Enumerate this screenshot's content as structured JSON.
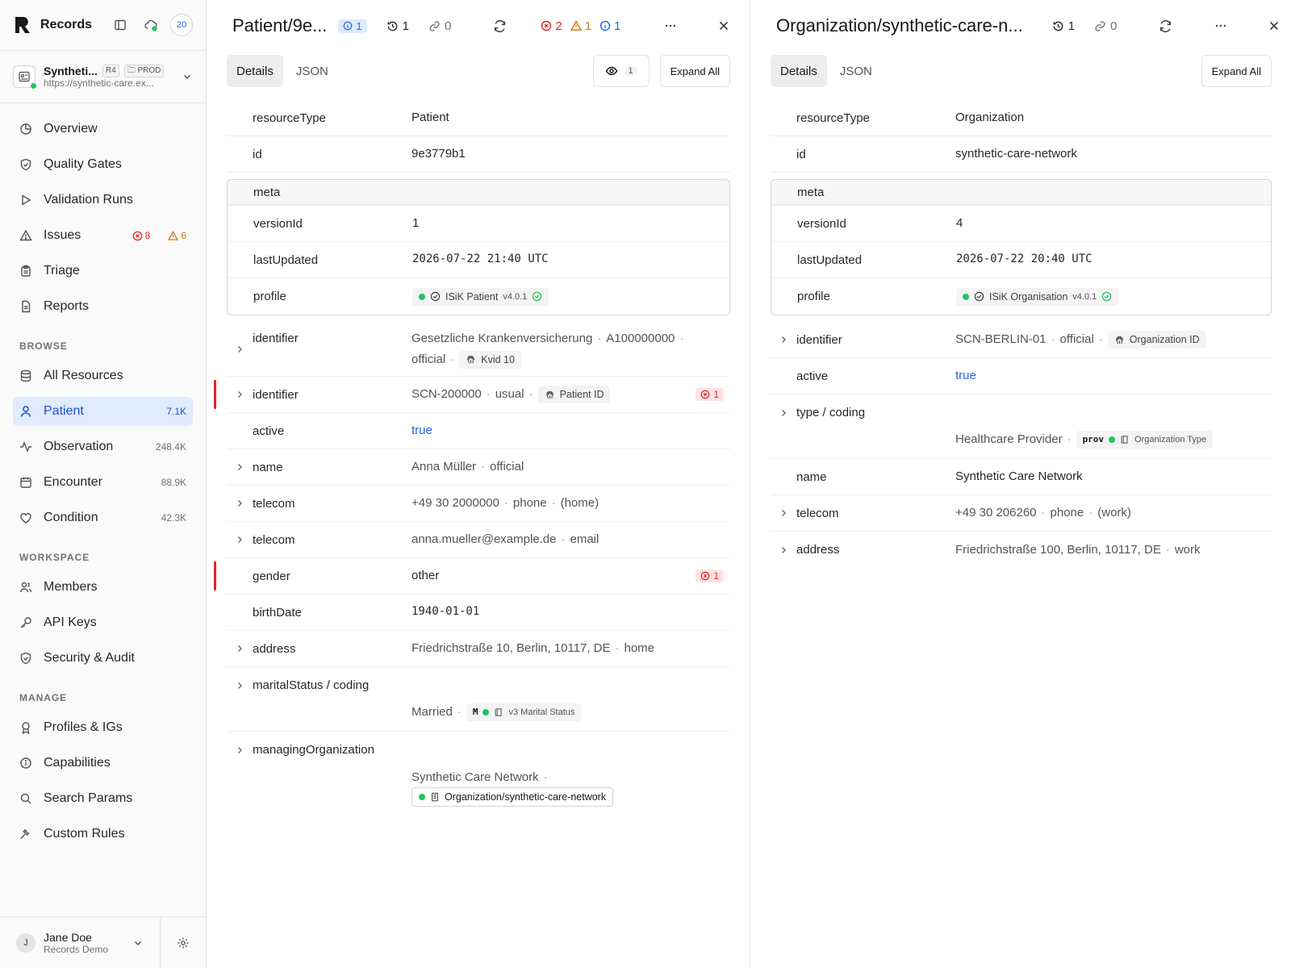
{
  "sidebar": {
    "app_name": "Records",
    "notif_count": "20",
    "workspace": {
      "name": "Syntheti...",
      "fhir": "R4",
      "env": "PROD",
      "url": "https://synthetic-care.ex..."
    },
    "nav_main": [
      {
        "label": "Overview",
        "icon": "pie-chart-icon"
      },
      {
        "label": "Quality Gates",
        "icon": "shield-check-icon"
      },
      {
        "label": "Validation Runs",
        "icon": "play-icon"
      },
      {
        "label": "Issues",
        "icon": "warning-icon",
        "errors": "8",
        "warnings": "6"
      },
      {
        "label": "Triage",
        "icon": "clipboard-icon"
      },
      {
        "label": "Reports",
        "icon": "document-icon"
      }
    ],
    "browse_title": "BROWSE",
    "nav_browse": [
      {
        "label": "All Resources",
        "count": ""
      },
      {
        "label": "Patient",
        "count": "7.1K"
      },
      {
        "label": "Observation",
        "count": "248.4K"
      },
      {
        "label": "Encounter",
        "count": "88.9K"
      },
      {
        "label": "Condition",
        "count": "42.3K"
      }
    ],
    "workspace_title": "WORKSPACE",
    "nav_workspace": [
      {
        "label": "Members"
      },
      {
        "label": "API Keys"
      },
      {
        "label": "Security & Audit"
      }
    ],
    "manage_title": "MANAGE",
    "nav_manage": [
      {
        "label": "Profiles & IGs"
      },
      {
        "label": "Capabilities"
      },
      {
        "label": "Search Params"
      },
      {
        "label": "Custom Rules"
      }
    ],
    "user": {
      "initial": "J",
      "name": "Jane Doe",
      "org": "Records Demo"
    }
  },
  "left": {
    "title": "Patient/9e...",
    "info_badge": "1",
    "history": "1",
    "links": "0",
    "errors": "2",
    "warnings": "1",
    "infos": "1",
    "tab_details": "Details",
    "tab_json": "JSON",
    "eye_count": "1",
    "expand_all": "Expand All",
    "resourceType_key": "resourceType",
    "resourceType": "Patient",
    "id_key": "id",
    "id": "9e3779b1",
    "meta_key": "meta",
    "versionId_key": "versionId",
    "versionId": "1",
    "lastUpdated_key": "lastUpdated",
    "lastUpdated": "2026-07-22 21:40 UTC",
    "profile_key": "profile",
    "profile_name": "ISiK Patient",
    "profile_ver": "v4.0.1",
    "identifier_key": "identifier",
    "id1_type": "Gesetzliche Krankenversicherung",
    "id1_value": "A100000000",
    "id1_use": "official",
    "id1_chip": "Kvid 10",
    "id2_value": "SCN-200000",
    "id2_use": "usual",
    "id2_chip": "Patient ID",
    "id2_err": "1",
    "active_key": "active",
    "active": "true",
    "name_key": "name",
    "name": "Anna Müller",
    "name_use": "official",
    "telecom_key": "telecom",
    "tel1": "+49 30 2000000",
    "tel1_sys": "phone",
    "tel1_use": "(home)",
    "tel2": "anna.mueller@example.de",
    "tel2_sys": "email",
    "gender_key": "gender",
    "gender": "other",
    "gender_err": "1",
    "birthDate_key": "birthDate",
    "birthDate": "1940-01-01",
    "address_key": "address",
    "address": "Friedrichstraße 10, Berlin, 10117, DE",
    "address_use": "home",
    "marital_key": "maritalStatus / coding",
    "marital": "Married",
    "marital_code": "M",
    "marital_sys": "v3 Marital Status",
    "mo_key": "managingOrganization",
    "mo_display": "Synthetic Care Network",
    "mo_ref": "Organization/synthetic-care-network"
  },
  "right": {
    "title": "Organization/synthetic-care-n...",
    "history": "1",
    "links": "0",
    "tab_details": "Details",
    "tab_json": "JSON",
    "expand_all": "Expand All",
    "resourceType_key": "resourceType",
    "resourceType": "Organization",
    "id_key": "id",
    "id": "synthetic-care-network",
    "meta_key": "meta",
    "versionId_key": "versionId",
    "versionId": "4",
    "lastUpdated_key": "lastUpdated",
    "lastUpdated": "2026-07-22 20:40 UTC",
    "profile_key": "profile",
    "profile_name": "ISiK Organisation",
    "profile_ver": "v4.0.1",
    "identifier_key": "identifier",
    "id_value": "SCN-BERLIN-01",
    "id_use": "official",
    "id_chip": "Organization ID",
    "active_key": "active",
    "active": "true",
    "type_key": "type / coding",
    "type_display": "Healthcare Provider",
    "type_code": "prov",
    "type_sys": "Organization Type",
    "name_key": "name",
    "name": "Synthetic Care Network",
    "telecom_key": "telecom",
    "tel": "+49 30 206260",
    "tel_sys": "phone",
    "tel_use": "(work)",
    "address_key": "address",
    "address": "Friedrichstraße 100, Berlin, 10117, DE",
    "address_use": "work"
  },
  "colors": {
    "accent": "#2563eb",
    "error": "#dc2626",
    "warning": "#d97706",
    "ok": "#22c55e",
    "active_bg": "#e0ebfd"
  }
}
